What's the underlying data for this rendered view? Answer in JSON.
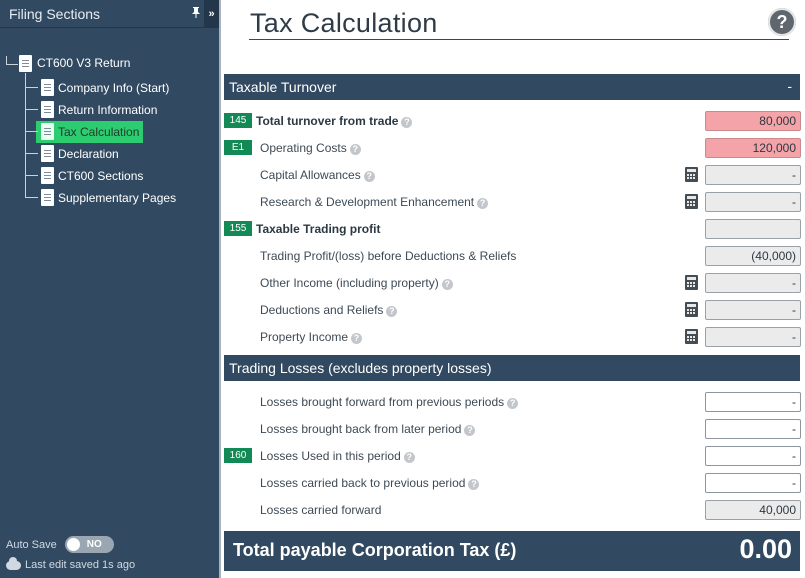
{
  "sidebar": {
    "title": "Filing Sections",
    "pin_icon": "pin-icon",
    "collapse_glyph": "»",
    "root_label": "CT600 V3 Return",
    "items": [
      {
        "label": "Company Info (Start)",
        "active": false
      },
      {
        "label": "Return Information",
        "active": false
      },
      {
        "label": "Tax Calculation",
        "active": true
      },
      {
        "label": "Declaration",
        "active": false
      },
      {
        "label": "CT600 Sections",
        "active": false
      },
      {
        "label": "Supplementary Pages",
        "active": false
      }
    ],
    "autosave_label": "Auto Save",
    "autosave_toggle": "NO",
    "last_edit": "Last edit saved 1s ago"
  },
  "main": {
    "title": "Tax Calculation",
    "help_glyph": "?",
    "section_taxable": {
      "title": "Taxable Turnover",
      "collapse": "-"
    },
    "rows_taxable": [
      {
        "code": "145",
        "label": "Total turnover from trade",
        "value": "80,000"
      },
      {
        "code": "E1",
        "label": "Operating Costs",
        "value": "120,000"
      },
      {
        "code": "",
        "label": "Capital Allowances",
        "value": "-"
      },
      {
        "code": "",
        "label": "Research & Development Enhancement",
        "value": "-"
      },
      {
        "code": "155",
        "label": "Taxable Trading profit",
        "value": ""
      },
      {
        "code": "",
        "label": "Trading Profit/(loss) before Deductions & Reliefs",
        "value": "(40,000)"
      },
      {
        "code": "",
        "label": "Other Income (including property)",
        "value": "-"
      },
      {
        "code": "",
        "label": "Deductions and Reliefs",
        "value": "-"
      },
      {
        "code": "",
        "label": "Property Income",
        "value": "-"
      }
    ],
    "section_losses": {
      "title": "Trading Losses (excludes property losses)"
    },
    "rows_losses": [
      {
        "code": "",
        "label": "Losses brought forward from previous periods",
        "value": "-"
      },
      {
        "code": "",
        "label": "Losses brought back from later period",
        "value": "-"
      },
      {
        "code": "160",
        "label": "Losses Used in this period",
        "value": "-"
      },
      {
        "code": "",
        "label": "Losses carried back to previous period",
        "value": "-"
      },
      {
        "code": "",
        "label": "Losses carried forward",
        "value": "40,000"
      }
    ],
    "total": {
      "label": "Total payable Corporation Tax (£)",
      "value": "0.00"
    }
  },
  "colors": {
    "navy": "#324a61",
    "code_green": "#138a55",
    "active_green": "#2ecc71",
    "negative_red": "#f4a3a8"
  }
}
